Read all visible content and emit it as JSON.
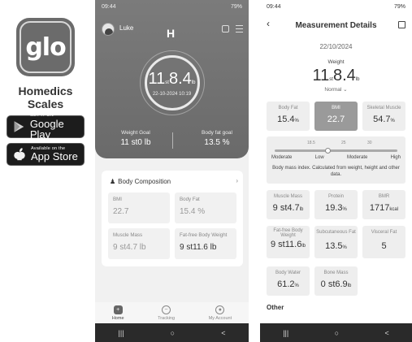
{
  "brand": {
    "logo_text": "glo",
    "name": "Homedics Scales",
    "google_small": "GET IT ON",
    "google_big": "Google Play",
    "apple_small": "Available on the",
    "apple_big": "App Store"
  },
  "phone1": {
    "status_time": "09:44",
    "status_right": "79%",
    "user": "Luke",
    "header_logo": "H",
    "weight_st": "11",
    "weight_st_unit": "st",
    "weight_lb": "8.4",
    "weight_lb_unit": "lb",
    "datetime": "22-10-2024 10:19",
    "weight_goal_label": "Weight Goal",
    "weight_goal_value": "11 st0 lb",
    "fat_goal_label": "Body fat goal",
    "fat_goal_value": "13.5 %",
    "body_comp_title": "Body Composition",
    "tiles": [
      {
        "label": "BMI",
        "value": "22.7"
      },
      {
        "label": "Body Fat",
        "value": "15.4 %"
      },
      {
        "label": "Muscle Mass",
        "value": "9 st4.7 lb"
      },
      {
        "label": "Fat-free Body Weight",
        "value": "9 st11.6 lb"
      }
    ],
    "tabs": [
      "Home",
      "Tracking",
      "My Account"
    ]
  },
  "phone2": {
    "status_time": "09:44",
    "status_right": "79%",
    "title": "Measurement Details",
    "date": "22/10/2024",
    "weight_label": "Weight",
    "weight_st": "11",
    "weight_st_unit": "st",
    "weight_lb": "8.4",
    "weight_lb_unit": "lb",
    "status": "Normal",
    "row1": [
      {
        "label": "Body Fat",
        "value": "15.4",
        "unit": "%"
      },
      {
        "label": "BMI",
        "value": "22.7",
        "unit": ""
      },
      {
        "label": "Skeletal Muscle",
        "value": "54.7",
        "unit": "%"
      }
    ],
    "scale": {
      "ticks": [
        "18.5",
        "25",
        "30"
      ],
      "labels": [
        "Moderate",
        "Low",
        "Moderate",
        "High"
      ],
      "description": "Body mass index. Calculated from weight, height and other data."
    },
    "row2": [
      {
        "label": "Muscle Mass",
        "value": "9 st4.7",
        "unit": "lb"
      },
      {
        "label": "Protein",
        "value": "19.3",
        "unit": "%"
      },
      {
        "label": "BMR",
        "value": "1717",
        "unit": "kcal"
      }
    ],
    "row3": [
      {
        "label": "Fat-free Body Weight",
        "value": "9 st11.6",
        "unit": "lb"
      },
      {
        "label": "Subcutaneous Fat",
        "value": "13.5",
        "unit": "%"
      },
      {
        "label": "Visceral Fat",
        "value": "5",
        "unit": ""
      }
    ],
    "row4": [
      {
        "label": "Body Water",
        "value": "61.2",
        "unit": "%"
      },
      {
        "label": "Bone Mass",
        "value": "0 st6.9",
        "unit": "lb"
      }
    ],
    "other_title": "Other"
  },
  "nav": {
    "recent": "|||",
    "home": "○",
    "back": "<"
  }
}
